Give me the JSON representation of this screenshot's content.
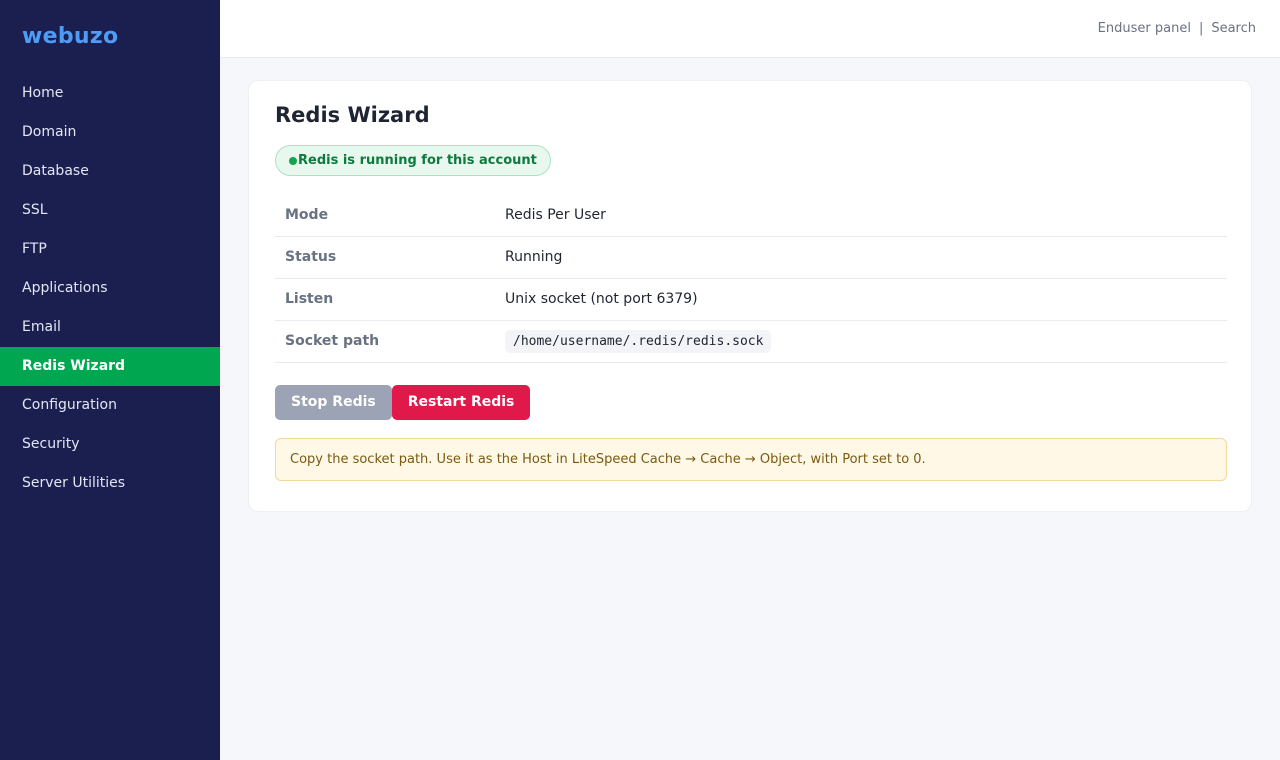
{
  "brand": "webuzo",
  "sidebar": {
    "items": [
      {
        "label": "Home",
        "active": false
      },
      {
        "label": "Domain",
        "active": false
      },
      {
        "label": "Database",
        "active": false
      },
      {
        "label": "SSL",
        "active": false
      },
      {
        "label": "FTP",
        "active": false
      },
      {
        "label": "Applications",
        "active": false
      },
      {
        "label": "Email",
        "active": false
      },
      {
        "label": "Redis Wizard",
        "active": true
      },
      {
        "label": "Configuration",
        "active": false
      },
      {
        "label": "Security",
        "active": false
      },
      {
        "label": "Server Utilities",
        "active": false
      }
    ]
  },
  "topbar": {
    "enduser_panel": "Enduser panel",
    "separator": "|",
    "search": "Search"
  },
  "page": {
    "title": "Redis Wizard",
    "status_badge": "Redis is running for this account",
    "rows": [
      {
        "label": "Mode",
        "value": "Redis Per User"
      },
      {
        "label": "Status",
        "value": "Running"
      },
      {
        "label": "Listen",
        "value": "Unix socket (not port 6379)"
      },
      {
        "label": "Socket path",
        "value": "/home/username/.redis/redis.sock"
      }
    ],
    "stop_label": "Stop Redis",
    "restart_label": "Restart Redis",
    "notice": "Copy the socket path. Use it as the Host in LiteSpeed Cache → Cache → Object, with Port set to 0."
  },
  "colors": {
    "sidebar_bg": "#1b1f4f",
    "brand": "#4f9cf7",
    "active": "#00a650",
    "stop_button": "#9ba3b4",
    "restart_button": "#e0194a",
    "success": "#13a54f"
  }
}
